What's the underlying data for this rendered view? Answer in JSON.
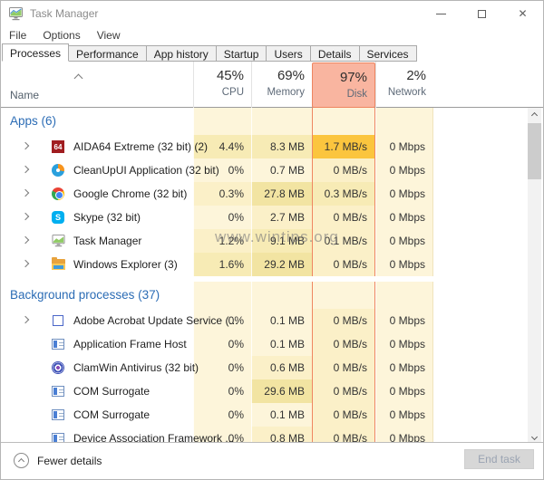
{
  "window": {
    "title": "Task Manager"
  },
  "window_controls": {
    "minimize": "minimize",
    "maximize": "maximize",
    "close": "close"
  },
  "menu": {
    "items": [
      "File",
      "Options",
      "View"
    ]
  },
  "tabs": [
    {
      "label": "Processes",
      "active": true
    },
    {
      "label": "Performance",
      "active": false
    },
    {
      "label": "App history",
      "active": false
    },
    {
      "label": "Startup",
      "active": false
    },
    {
      "label": "Users",
      "active": false
    },
    {
      "label": "Details",
      "active": false
    },
    {
      "label": "Services",
      "active": false
    }
  ],
  "header": {
    "name_label": "Name",
    "columns": [
      {
        "id": "cpu",
        "value": "45%",
        "label": "CPU",
        "highlighted": false
      },
      {
        "id": "mem",
        "value": "69%",
        "label": "Memory",
        "highlighted": false
      },
      {
        "id": "disk",
        "value": "97%",
        "label": "Disk",
        "highlighted": true
      },
      {
        "id": "net",
        "value": "2%",
        "label": "Network",
        "highlighted": false
      }
    ]
  },
  "groups": [
    {
      "label": "Apps (6)",
      "rows": [
        {
          "name": "AIDA64 Extreme (32 bit) (2)",
          "icon": "aida64-icon",
          "expandable": true,
          "cpu": "4.4%",
          "memory": "8.3 MB",
          "disk": "1.7 MB/s",
          "network": "0 Mbps",
          "heat": {
            "cpu": "h2",
            "memory": "h2",
            "disk": "hx",
            "network": "h0"
          }
        },
        {
          "name": "CleanUpUI Application (32 bit)",
          "icon": "cleanupui-icon",
          "expandable": true,
          "cpu": "0%",
          "memory": "0.7 MB",
          "disk": "0 MB/s",
          "network": "0 Mbps",
          "heat": {
            "cpu": "h0",
            "memory": "h0",
            "disk": "h1",
            "network": "h0"
          }
        },
        {
          "name": "Google Chrome (32 bit)",
          "icon": "chrome-icon",
          "expandable": true,
          "cpu": "0.3%",
          "memory": "27.8 MB",
          "disk": "0.3 MB/s",
          "network": "0 Mbps",
          "heat": {
            "cpu": "h1",
            "memory": "h3",
            "disk": "h2",
            "network": "h0"
          }
        },
        {
          "name": "Skype (32 bit)",
          "icon": "skype-icon",
          "expandable": true,
          "cpu": "0%",
          "memory": "2.7 MB",
          "disk": "0 MB/s",
          "network": "0 Mbps",
          "heat": {
            "cpu": "h0",
            "memory": "h1",
            "disk": "h1",
            "network": "h0"
          }
        },
        {
          "name": "Task Manager",
          "icon": "task-manager-icon",
          "expandable": true,
          "cpu": "1.2%",
          "memory": "9.1 MB",
          "disk": "0.1 MB/s",
          "network": "0 Mbps",
          "heat": {
            "cpu": "h1",
            "memory": "h2",
            "disk": "h1",
            "network": "h0"
          }
        },
        {
          "name": "Windows Explorer (3)",
          "icon": "folder-icon",
          "expandable": true,
          "cpu": "1.6%",
          "memory": "29.2 MB",
          "disk": "0 MB/s",
          "network": "0 Mbps",
          "heat": {
            "cpu": "h2",
            "memory": "h3",
            "disk": "h1",
            "network": "h0"
          }
        }
      ]
    },
    {
      "label": "Background processes (37)",
      "rows": [
        {
          "name": "Adobe Acrobat Update Service (...",
          "icon": "adobe-icon",
          "expandable": true,
          "cpu": "0%",
          "memory": "0.1 MB",
          "disk": "0 MB/s",
          "network": "0 Mbps",
          "heat": {
            "cpu": "h0",
            "memory": "h0",
            "disk": "h1",
            "network": "h0"
          }
        },
        {
          "name": "Application Frame Host",
          "icon": "app-window-icon",
          "expandable": false,
          "cpu": "0%",
          "memory": "0.1 MB",
          "disk": "0 MB/s",
          "network": "0 Mbps",
          "heat": {
            "cpu": "h0",
            "memory": "h0",
            "disk": "h1",
            "network": "h0"
          }
        },
        {
          "name": "ClamWin Antivirus (32 bit)",
          "icon": "clamwin-icon",
          "expandable": false,
          "cpu": "0%",
          "memory": "0.6 MB",
          "disk": "0 MB/s",
          "network": "0 Mbps",
          "heat": {
            "cpu": "h0",
            "memory": "h1",
            "disk": "h1",
            "network": "h0"
          }
        },
        {
          "name": "COM Surrogate",
          "icon": "app-window-icon",
          "expandable": false,
          "cpu": "0%",
          "memory": "29.6 MB",
          "disk": "0 MB/s",
          "network": "0 Mbps",
          "heat": {
            "cpu": "h0",
            "memory": "h3",
            "disk": "h1",
            "network": "h0"
          }
        },
        {
          "name": "COM Surrogate",
          "icon": "app-window-icon",
          "expandable": false,
          "cpu": "0%",
          "memory": "0.1 MB",
          "disk": "0 MB/s",
          "network": "0 Mbps",
          "heat": {
            "cpu": "h0",
            "memory": "h0",
            "disk": "h1",
            "network": "h0"
          }
        },
        {
          "name": "Device Association Framework ...",
          "icon": "app-window-icon",
          "expandable": false,
          "cpu": "0%",
          "memory": "0.8 MB",
          "disk": "0 MB/s",
          "network": "0 Mbps",
          "heat": {
            "cpu": "h0",
            "memory": "h1",
            "disk": "h1",
            "network": "h0"
          }
        }
      ]
    }
  ],
  "watermark": "www.wintips.org",
  "footer": {
    "details_toggle": "Fewer details",
    "end_task": "End task"
  },
  "colors": {
    "accent_blue": "#2b6cb5",
    "heat_base": "#fdf5da",
    "heat_high": "#fbc53e",
    "disk_border": "#ef8661",
    "disk_header_bg": "#f9b5a0"
  }
}
